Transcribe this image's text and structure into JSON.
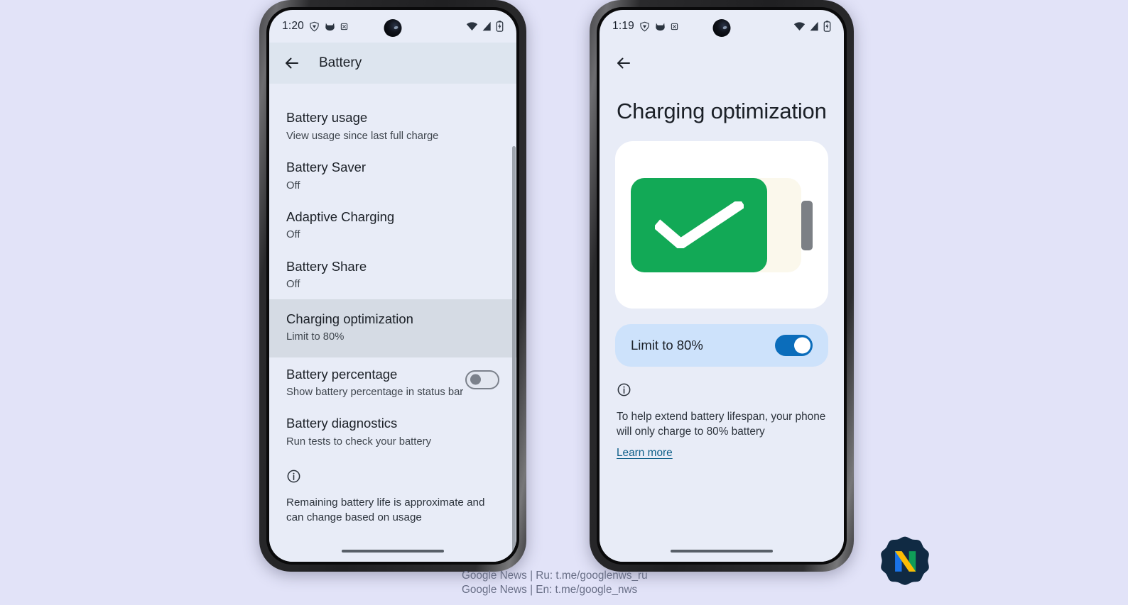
{
  "background_color": "#e2e3f8",
  "left_phone": {
    "status_bar": {
      "clock": "1:20",
      "left_icons": [
        "shield-vpn-icon",
        "cat-notification-icon",
        "app-notification-icon"
      ],
      "right_icons": [
        "wifi-icon",
        "cellular-signal-icon",
        "battery-charging-icon"
      ],
      "camera": "front-camera-punch-hole"
    },
    "app_bar": {
      "back_icon": "back-arrow-icon",
      "title": "Battery"
    },
    "list_items": [
      {
        "title": "Battery usage",
        "subtitle": "View usage since last full charge",
        "control": "none",
        "highlighted": false
      },
      {
        "title": "Battery Saver",
        "subtitle": "Off",
        "control": "none",
        "highlighted": false
      },
      {
        "title": "Adaptive Charging",
        "subtitle": "Off",
        "control": "none",
        "highlighted": false
      },
      {
        "title": "Battery Share",
        "subtitle": "Off",
        "control": "none",
        "highlighted": false
      },
      {
        "title": "Charging optimization",
        "subtitle": "Limit to 80%",
        "control": "none",
        "highlighted": true
      },
      {
        "title": "Battery percentage",
        "subtitle": "Show battery percentage in status bar",
        "control": "toggle-off",
        "highlighted": false
      },
      {
        "title": "Battery diagnostics",
        "subtitle": "Run tests to check your battery",
        "control": "none",
        "highlighted": false
      }
    ],
    "footnote": {
      "icon": "info-icon",
      "text": "Remaining battery life is approximate and can change based on usage"
    },
    "scrollbar": "vertical-scrollbar",
    "nav_pill": "gesture-nav-pill"
  },
  "right_phone": {
    "status_bar": {
      "clock": "1:19",
      "left_icons": [
        "shield-vpn-icon",
        "cat-notification-icon",
        "app-notification-icon"
      ],
      "right_icons": [
        "wifi-icon",
        "cellular-signal-icon",
        "battery-charging-icon"
      ],
      "camera": "front-camera-punch-hole"
    },
    "back_icon": "back-arrow-icon",
    "page_title": "Charging optimization",
    "illustration": {
      "name": "battery-check-illustration",
      "fill_percent": 80,
      "fill_color": "#12a956",
      "empty_color": "#fbf8ec",
      "cap_color": "#7c8085",
      "card_color": "#ffffff"
    },
    "limit_row": {
      "label": "Limit to 80%",
      "toggle_state": "on",
      "toggle_color": "#0b6dbb",
      "row_color": "#cde2fb"
    },
    "footnote": {
      "icon": "info-icon",
      "text": "To help extend battery lifespan, your phone will only charge to 80% battery",
      "link": "Learn more",
      "link_color": "#0b5d87"
    },
    "nav_pill": "gesture-nav-pill"
  },
  "watermark": {
    "line1": "Google News | Ru: t.me/googlenws_ru",
    "line2": "Google News | En: t.me/google_nws",
    "logo": "google-news-n-logo"
  }
}
